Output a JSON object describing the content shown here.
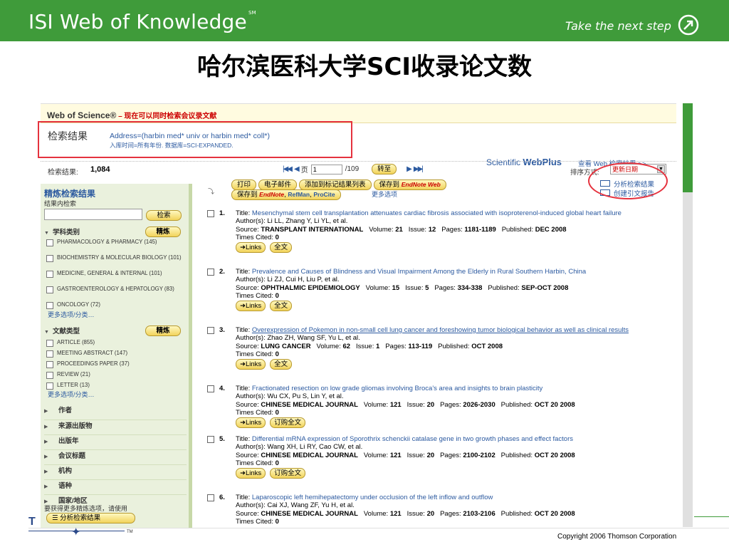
{
  "banner": {
    "brand": "ISI Web of Knowledge",
    "brand_mark": "SM",
    "tagline": "Take the next step"
  },
  "slide_title": "哈尔滨医科大学SCI收录论文数",
  "wos": {
    "title": "Web of Science®",
    "subtitle": " – 现在可以同时检索会议录文献",
    "result_label": "检索结果",
    "query": "Address=(harbin med* univ or harbin med* coll*)",
    "query_sub": "入库时间=所有年份. 数据库=SCI-EXPANDED.",
    "scientific_prefix": "Scientific ",
    "scientific_bold": "WebPlus",
    "search_web": "查看 Web 检索结果 >>",
    "count_label": "检索结果:",
    "count_value": "1,084",
    "page_label": "页",
    "page_value": "1",
    "page_total": "/109",
    "go_label": "转至",
    "sort_label": "排序方式:",
    "sort_value": "更新日期"
  },
  "actions": {
    "print": "打印",
    "email": "电子邮件",
    "add_marked": "添加到标记结果列表",
    "save_to": "保存到",
    "endnote_web": "EndNote Web",
    "save_to2": "保存到",
    "endnote": "EndNote",
    "refman": "RefMan",
    "procite": "ProCite",
    "more_options": "更多选项",
    "analyze": "分析检索结果",
    "citation_report": "创建引文报告"
  },
  "sidebar": {
    "refine_title": "精炼检索结果",
    "within_label": "结果内检索",
    "search_btn": "检索",
    "refine_btn": "精炼",
    "subject_head": "学科类别",
    "subjects": [
      "PHARMACOLOGY & PHARMACY (145)",
      "BIOCHEMISTRY & MOLECULAR BIOLOGY (101)",
      "MEDICINE, GENERAL & INTERNAL (101)",
      "GASTROENTEROLOGY & HEPATOLOGY (83)",
      "ONCOLOGY (72)"
    ],
    "more_1": "更多选项/分类…",
    "doctype_head": "文献类型",
    "doctypes": [
      "ARTICLE (855)",
      "MEETING ABSTRACT (147)",
      "PROCEEDINGS PAPER (37)",
      "REVIEW (21)",
      "LETTER (13)"
    ],
    "more_2": "更多选项/分类…",
    "collapsed": [
      "作者",
      "来源出版物",
      "出版年",
      "会议标题",
      "机构",
      "语种",
      "国家/地区"
    ],
    "use_analysis": "要获得更多精炼选项，请使用",
    "analysis_btn": "分析检索结果"
  },
  "records": [
    {
      "num": "1.",
      "title": "Mesenchymal stem cell transplantation attenuates cardiac fibrosis associated with isoproterenol-induced global heart failure",
      "authors": "Author(s): Li LL, Zhang Y, Li YL, et al.",
      "source": "TRANSPLANT INTERNATIONAL",
      "volume": "21",
      "issue": "12",
      "pages": "1181-1189",
      "published": "DEC 2008",
      "cited": "0",
      "btn2": "全文"
    },
    {
      "num": "2.",
      "title": "Prevalence and Causes of Blindness and Visual Impairment Among the Elderly in Rural Southern Harbin, China",
      "authors": "Author(s): Li ZJ, Cui H, Liu P, et al.",
      "source": "OPHTHALMIC EPIDEMIOLOGY",
      "volume": "15",
      "issue": "5",
      "pages": "334-338",
      "published": "SEP-OCT 2008",
      "cited": "0",
      "btn2": "全文"
    },
    {
      "num": "3.",
      "title": "Overexpression of Pokemon in non-small cell lung cancer and foreshowing tumor biological behavior as well as clinical results",
      "authors": "Author(s): Zhao ZH, Wang SF, Yu L, et al.",
      "source": "LUNG CANCER",
      "volume": "62",
      "issue": "1",
      "pages": "113-119",
      "published": "OCT 2008",
      "cited": "0",
      "btn2": "全文"
    },
    {
      "num": "4.",
      "title": "Fractionated resection on low grade gliomas involving Broca's area and insights to brain plasticity",
      "authors": "Author(s): Wu CX, Pu S, Lin Y, et al.",
      "source": "CHINESE MEDICAL JOURNAL",
      "volume": "121",
      "issue": "20",
      "pages": "2026-2030",
      "published": "OCT 20 2008",
      "cited": "0",
      "btn2": "订购全文"
    },
    {
      "num": "5.",
      "title": "Differential mRNA expression of Sporothrix schenckii catalase gene in two growth phases and effect factors",
      "authors": "Author(s): Wang XH, Li RY, Cao CW, et al.",
      "source": "CHINESE MEDICAL JOURNAL",
      "volume": "121",
      "issue": "20",
      "pages": "2100-2102",
      "published": "OCT 20 2008",
      "cited": "0",
      "btn2": "订购全文"
    },
    {
      "num": "6.",
      "title": "Laparoscopic left hemihepatectomy under occlusion of the left inflow and outflow",
      "authors": "Author(s): Cai XJ, Wang ZF, Yu H, et al.",
      "source": "CHINESE MEDICAL JOURNAL",
      "volume": "121",
      "issue": "20",
      "pages": "2103-2106",
      "published": "OCT 20 2008",
      "cited": "0",
      "btn2": ""
    }
  ],
  "labels": {
    "title": "Title: ",
    "source": "Source: ",
    "volume": "Volume: ",
    "issue": "Issue: ",
    "pages": "Pages: ",
    "published": "Published: ",
    "cited": "Times Cited: ",
    "links": "Links"
  },
  "footer": {
    "copyright": "Copyright 2006 Thomson Corporation",
    "tm": "TM",
    "letter": "T"
  },
  "colors": {
    "banner_green": "#3f9b3a",
    "link_blue": "#2c5aa0",
    "highlight_red": "#e5323e"
  }
}
